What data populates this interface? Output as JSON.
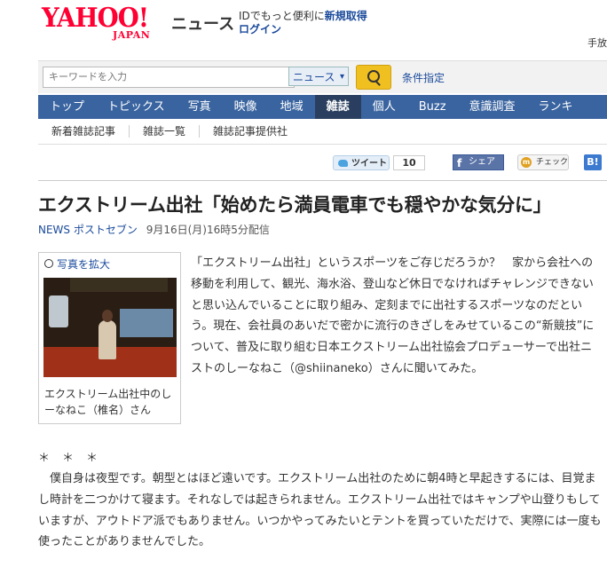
{
  "header": {
    "logo_main": "YAHOO!",
    "logo_sub": "JAPAN",
    "site_name": "ニュース",
    "login_prefix": "IDでもっと便利に",
    "signup_link": "新規取得",
    "login_link": "ログイン",
    "top_right_text": "手放"
  },
  "search": {
    "placeholder": "キーワードを入力",
    "category": "ニュース",
    "condition_link": "条件指定"
  },
  "nav": {
    "items": [
      "トップ",
      "トピックス",
      "写真",
      "映像",
      "地域",
      "雑誌",
      "個人",
      "Buzz",
      "意識調査",
      "ランキ"
    ],
    "active": "雑誌"
  },
  "subnav": {
    "items": [
      "新着雑誌記事",
      "雑誌一覧",
      "雑誌記事提供社"
    ]
  },
  "social": {
    "tweet_label": "ツイート",
    "tweet_count": "10",
    "facebook_label": "シェア",
    "check_label": "チェック",
    "hatena_label": "B!"
  },
  "article": {
    "title": "エクストリーム出社「始めたら満員電車でも穏やかな気分に」",
    "source": "NEWS ポストセブン",
    "date": "9月16日(月)16時5分配信",
    "photo_enlarge": "写真を拡大",
    "photo_caption": "エクストリーム出社中のしーなねこ（椎名）さん",
    "lead": "「エクストリーム出社」というスポーツをご存じだろうか？　家から会社への移動を利用して、観光、海水浴、登山など休日でなければチャレンジできないと思い込んでいることに取り組み、定刻までに出社するスポーツなのだという。現在、会社員のあいだで密かに流行のきざしをみせているこの“新競技”について、普及に取り組む日本エクストリーム出社協会プロデューサーで出社ニストのしーなねこ（@shiinaneko）さんに聞いてみた。",
    "separator": "＊＊＊",
    "body": "　僕自身は夜型です。朝型とはほど遠いです。エクストリーム出社のために朝4時と早起きするには、目覚まし時計を二つかけて寝ます。それなしでは起きられません。エクストリーム出社ではキャンプや山登りもしていますが、アウトドア派でもありません。いつかやってみたいとテントを買っていただけで、実際には一度も使ったことがありませんでした。"
  }
}
